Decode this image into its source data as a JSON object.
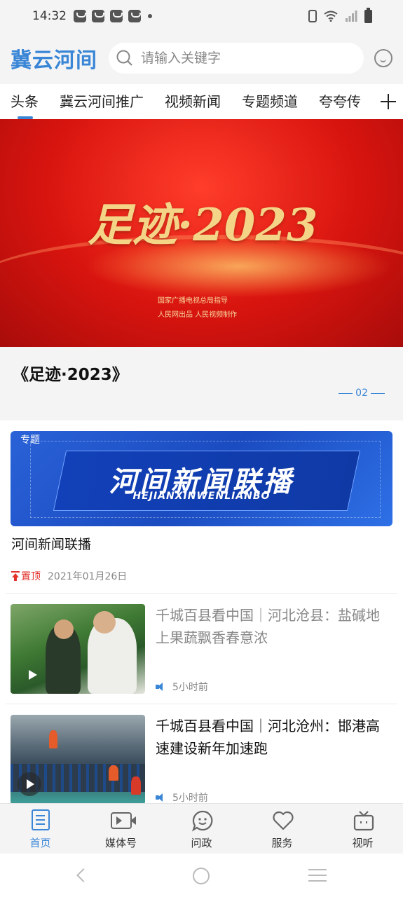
{
  "status_bar": {
    "time": "14:32"
  },
  "header": {
    "logo": "冀云河间",
    "search_placeholder": "请输入关键字"
  },
  "tabs": [
    {
      "label": "头条",
      "active": true
    },
    {
      "label": "冀云河间推广"
    },
    {
      "label": "视频新闻"
    },
    {
      "label": "专题频道"
    },
    {
      "label": "夸夸传"
    }
  ],
  "banner": {
    "title": "足迹·2023",
    "subtitle_line1": "国家广播电视总局指导",
    "subtitle_line2": "人民网出品 人民视频制作",
    "caption": "《足迹·2023》",
    "page_indicator": "02"
  },
  "feed": {
    "special": {
      "tag": "专题",
      "title": "河间新闻联播",
      "pinyin": "HEJIANXINWENLIANBO",
      "item_title": "河间新闻联播",
      "pinned_label": "置顶",
      "date": "2021年01月26日"
    },
    "news": [
      {
        "title": "千城百县看中国｜河北沧县：盐碱地上果蔬飘香春意浓",
        "time": "5小时前",
        "read": true
      },
      {
        "title": "千城百县看中国｜河北沧州：邯港高速建设新年加速跑",
        "time": "5小时前",
        "read": false
      }
    ]
  },
  "bottom_nav": [
    {
      "label": "首页",
      "icon": "home-doc-icon",
      "active": true
    },
    {
      "label": "媒体号",
      "icon": "video-camera-icon"
    },
    {
      "label": "问政",
      "icon": "chat-bubble-icon"
    },
    {
      "label": "服务",
      "icon": "heart-icon"
    },
    {
      "label": "视听",
      "icon": "tv-icon"
    }
  ],
  "colors": {
    "accent": "#3a86d6",
    "pin": "#e2332a"
  }
}
